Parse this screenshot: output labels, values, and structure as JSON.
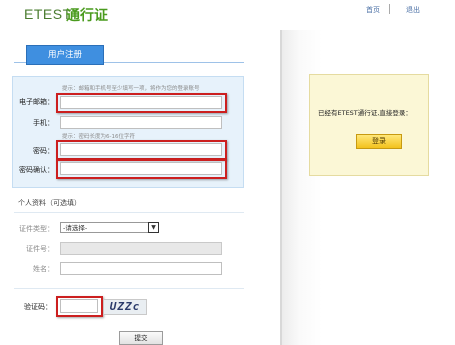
{
  "header": {
    "logo_text": "ETEST",
    "logo_subtitle": "通行证",
    "links": [
      "首页",
      "退出"
    ]
  },
  "register": {
    "tab_label": "用户注册",
    "email_hint": "提示：邮箱和手机号至少填写一项，将作为您的登录账号",
    "email_label": "电子邮箱：",
    "phone_label": "手机：",
    "password_hint": "提示：密码长度为6-16位字符",
    "password_label": "密码：",
    "confirm_label": "密码确认："
  },
  "personal": {
    "section_title": "个人资料（可选填）",
    "id_type_label": "证件类型：",
    "id_type_value": "-请选择-",
    "id_number_label": "证件号：",
    "name_label": "姓名："
  },
  "captcha": {
    "label": "验证码：",
    "image_text": "UZZc"
  },
  "submit_label": "提交",
  "login": {
    "text": "已经有ETEST通行证,直接登录：",
    "button_label": "登录"
  },
  "colors": {
    "tab_blue": "#3f8fe0",
    "highlight_red": "#cc1f1f",
    "login_button_yellow": "#f3c21c"
  }
}
